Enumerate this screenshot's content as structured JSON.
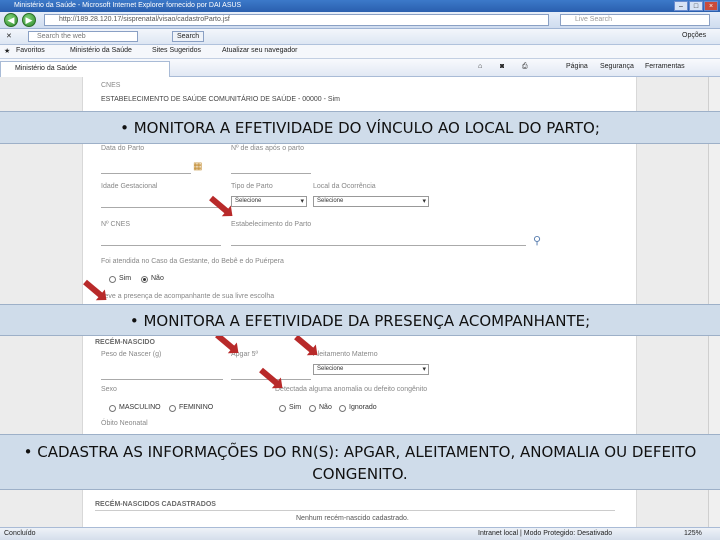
{
  "window": {
    "title": "Ministério da Saúde - Microsoft Internet Explorer fornecido por DAI ASUS",
    "url": "http://189.28.120.17/sisprenatal/visao/cadastroParto.jsf",
    "live_search_placeholder": "Live Search"
  },
  "toolbar": {
    "search_placeholder": "Search the web",
    "search_button": "Search",
    "options": "Opções"
  },
  "favorites": {
    "label": "Favoritos",
    "items": [
      "Ministério da Saúde",
      "Sites Sugeridos",
      "Atualizar seu navegador"
    ]
  },
  "tab": {
    "label": "Ministério da Saúde"
  },
  "commands": [
    "Página",
    "Segurança",
    "Ferramentas"
  ],
  "form": {
    "cnes_label": "CNES",
    "cnes_value": "ESTABELECIMENTO DE SAÚDE COMUNITÁRIO DE SAÚDE - 00000 - Sim",
    "data_parto": "Data do Parto",
    "dias_apos_parto": "Nº de dias após o parto",
    "idade_gestacional": "Idade Gestacional",
    "tipo_parto": "Tipo de Parto",
    "local_ocorrencia": "Local da Ocorrência",
    "select_default": "Selecione",
    "cnes_num": "Nº CNES",
    "estabelecimento": "Estabelecimento do Parto",
    "atendido": "Foi atendida no Caso da Gestante, do Bebê e do Puérpera",
    "sim": "Sim",
    "nao": "Não",
    "acompanhante": "Teve a presença de acompanhante de sua livre escolha",
    "recem_nascido": "RECÉM-NASCIDO",
    "peso_nascer": "Peso de Nascer (g)",
    "apgar": "Apgar 5º",
    "aleitamento": "Aleitamento Materno",
    "sexo": "Sexo",
    "masculino": "MASCULINO",
    "feminino": "FEMININO",
    "anomalia": "Detectada alguma anomalia ou defeito congênito",
    "ignorado": "Ignorado",
    "obito": "Óbito Neonatal",
    "rn_cadastrados": "RECÉM-NASCIDOS CADASTRADOS",
    "nenhum": "Nenhum recém-nascido cadastrado."
  },
  "banners": [
    "• MONITORA A EFETIVIDADE DO VÍNCULO AO LOCAL DO PARTO;",
    "• MONITORA A EFETIVIDADE DA PRESENÇA ACOMPANHANTE;",
    "• CADASTRA AS INFORMAÇÕES DO RN(S): APGAR, ALEITAMENTO, ANOMALIA OU DEFEITO CONGENITO."
  ],
  "status": {
    "left": "Concluído",
    "zone": "Intranet local | Modo Protegido: Desativado",
    "zoom": "125%"
  }
}
